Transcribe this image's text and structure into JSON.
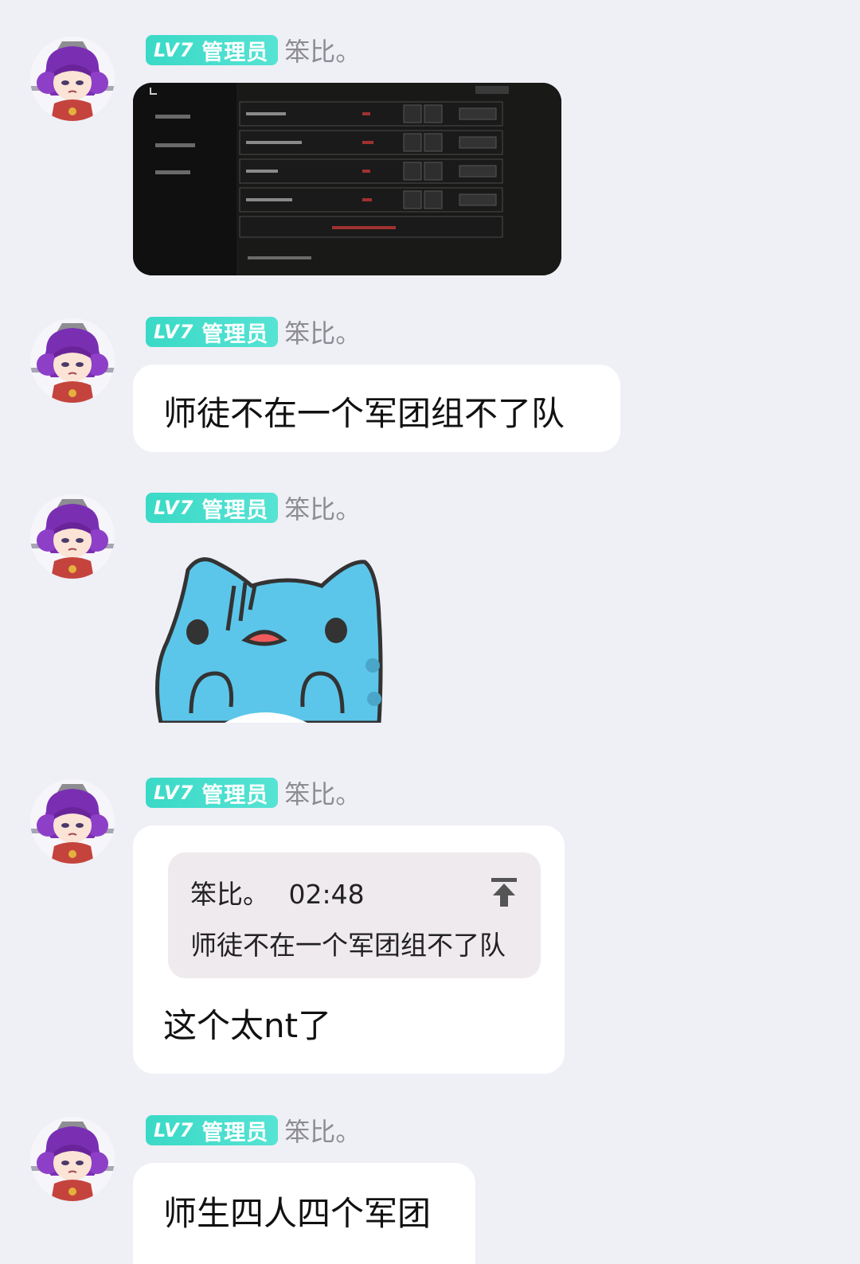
{
  "colors": {
    "background": "#efeff6",
    "badge": "#3ad9c6",
    "bubble": "#ffffff",
    "quote_bg": "#efeaee"
  },
  "messages": [
    {
      "badge_level": "LV7",
      "badge_role": "管理员",
      "nickname": "笨比。",
      "type": "image"
    },
    {
      "badge_level": "LV7",
      "badge_role": "管理员",
      "nickname": "笨比。",
      "type": "text",
      "text": "师徒不在一个军团组不了队"
    },
    {
      "badge_level": "LV7",
      "badge_role": "管理员",
      "nickname": "笨比。",
      "type": "sticker",
      "sticker": "blue-cat-sticker"
    },
    {
      "badge_level": "LV7",
      "badge_role": "管理员",
      "nickname": "笨比。",
      "type": "reply",
      "quote": {
        "author": "笨比。",
        "time": "02:48",
        "text": "师徒不在一个军团组不了队",
        "icon": "jump-to-top-icon"
      },
      "text": "这个太nt了"
    },
    {
      "badge_level": "LV7",
      "badge_role": "管理员",
      "nickname": "笨比。",
      "type": "text",
      "text": "师生四人四个军团"
    }
  ]
}
